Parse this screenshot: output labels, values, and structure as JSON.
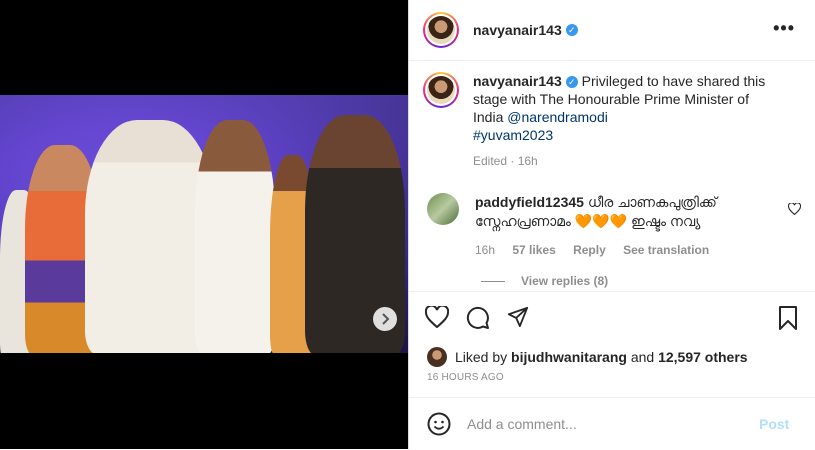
{
  "post": {
    "username": "navyanair143",
    "caption_text": "Privileged to have shared this stage with The Honourable Prime Minister of India",
    "mention": "@narendramodi",
    "hashtag": "#yuvam2023",
    "edited_meta": "Edited · 16h"
  },
  "comment": {
    "username": "paddyfield12345",
    "text": "ധീര ചാണകപുത്രിക്ക് സ്നേഹപ്രണാമം 🧡🧡🧡 ഇഷ്ടം നവ്യ",
    "time": "16h",
    "likes": "57 likes",
    "reply_label": "Reply",
    "translate_label": "See translation",
    "view_replies": "View replies (8)"
  },
  "likes": {
    "liked_by_prefix": "Liked by",
    "liked_by_user": "bijudhwanitarang",
    "and_text": "and",
    "others_count": "12,597 others"
  },
  "timestamp": "16 HOURS AGO",
  "add_comment": {
    "placeholder": "Add a comment...",
    "post_label": "Post"
  },
  "icons": {
    "more": "more-options-icon",
    "verified": "verified-badge-icon",
    "like": "heart-icon",
    "comment": "comment-icon",
    "share": "share-icon",
    "save": "bookmark-icon",
    "emoji": "emoji-icon",
    "next": "chevron-right-icon"
  },
  "colors": {
    "verified": "#3897f0",
    "link": "#00376b",
    "post_disabled": "#b2dffc"
  }
}
